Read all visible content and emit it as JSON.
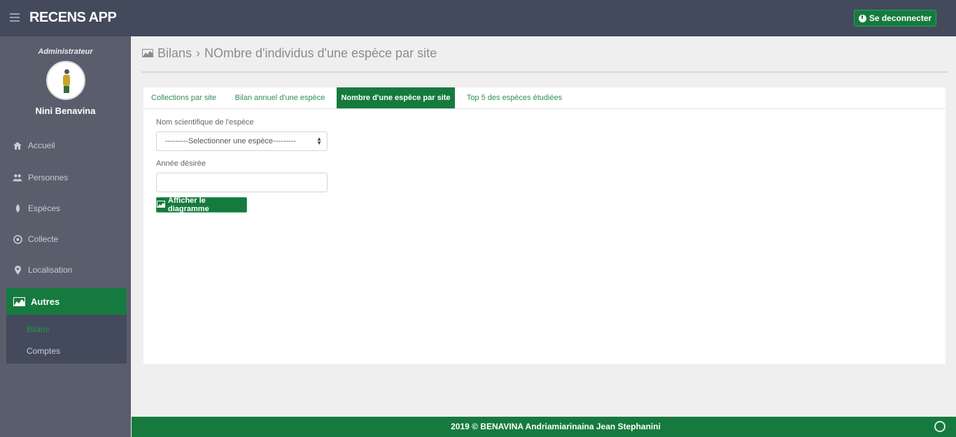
{
  "header": {
    "app_title": "RECENS APP",
    "logout_label": "Se deconnecter"
  },
  "sidebar": {
    "role": "Administrateur",
    "username": "Nini Benavina",
    "items": [
      {
        "label": "Accueil",
        "icon": "home-icon"
      },
      {
        "label": "Personnes",
        "icon": "users-icon"
      },
      {
        "label": "Espèces",
        "icon": "species-icon"
      },
      {
        "label": "Collecte",
        "icon": "collect-icon"
      },
      {
        "label": "Localisation",
        "icon": "map-marker-icon"
      },
      {
        "label": "Autres",
        "icon": "chart-area-icon"
      }
    ],
    "submenu": [
      {
        "label": "Bilans"
      },
      {
        "label": "Comptes"
      }
    ]
  },
  "main": {
    "breadcrumb_section": "Bilans",
    "breadcrumb_separator": "›",
    "breadcrumb_page": "NOmbre d'individus d'une espèce par site",
    "tabs": [
      {
        "label": "Collections par site"
      },
      {
        "label": "Bilan annuel d'une espèce"
      },
      {
        "label": "Nombre d'une espèce par site"
      },
      {
        "label": "Top 5 des espèces étudiées"
      }
    ],
    "form": {
      "species_label": "Nom scientifique de l'espèce",
      "species_selected": "---------Selectionner une espèce---------",
      "year_label": "Année désirée",
      "year_value": "",
      "submit_label": "Afficher le diagramme"
    }
  },
  "footer": {
    "text": "2019 © BENAVINA Andriamiarinaina Jean Stephanini"
  }
}
